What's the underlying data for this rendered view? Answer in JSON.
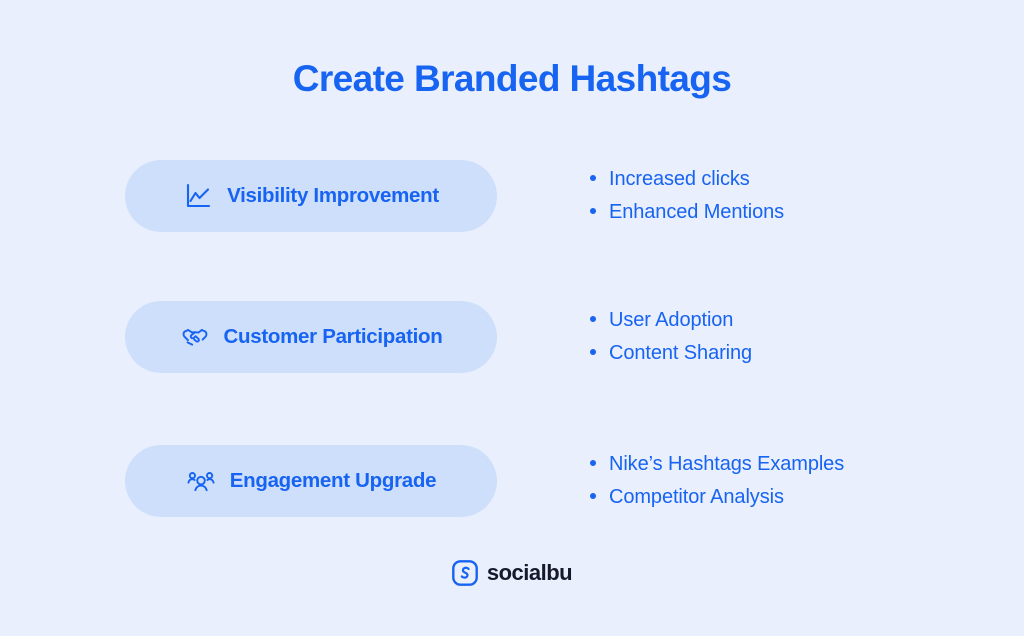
{
  "title": "Create Branded Hashtags",
  "theme": {
    "background": "#e9effd",
    "pill_fill": "#cedffc",
    "accent_blue": "#1763f2",
    "logo_text_color": "#16192c"
  },
  "rows": [
    {
      "icon": "line-chart-icon",
      "label": "Visibility Improvement",
      "bullets": [
        "Increased clicks",
        "Enhanced Mentions"
      ]
    },
    {
      "icon": "handshake-icon",
      "label": "Customer Participation",
      "bullets": [
        "User Adoption",
        "Content Sharing"
      ]
    },
    {
      "icon": "people-group-icon",
      "label": "Engagement Upgrade",
      "bullets": [
        "Nike’s Hashtags Examples",
        "Competitor Analysis"
      ]
    }
  ],
  "footer": {
    "logo_mark": "socialbu-s-logo-icon",
    "logo_text": "socialbu"
  }
}
